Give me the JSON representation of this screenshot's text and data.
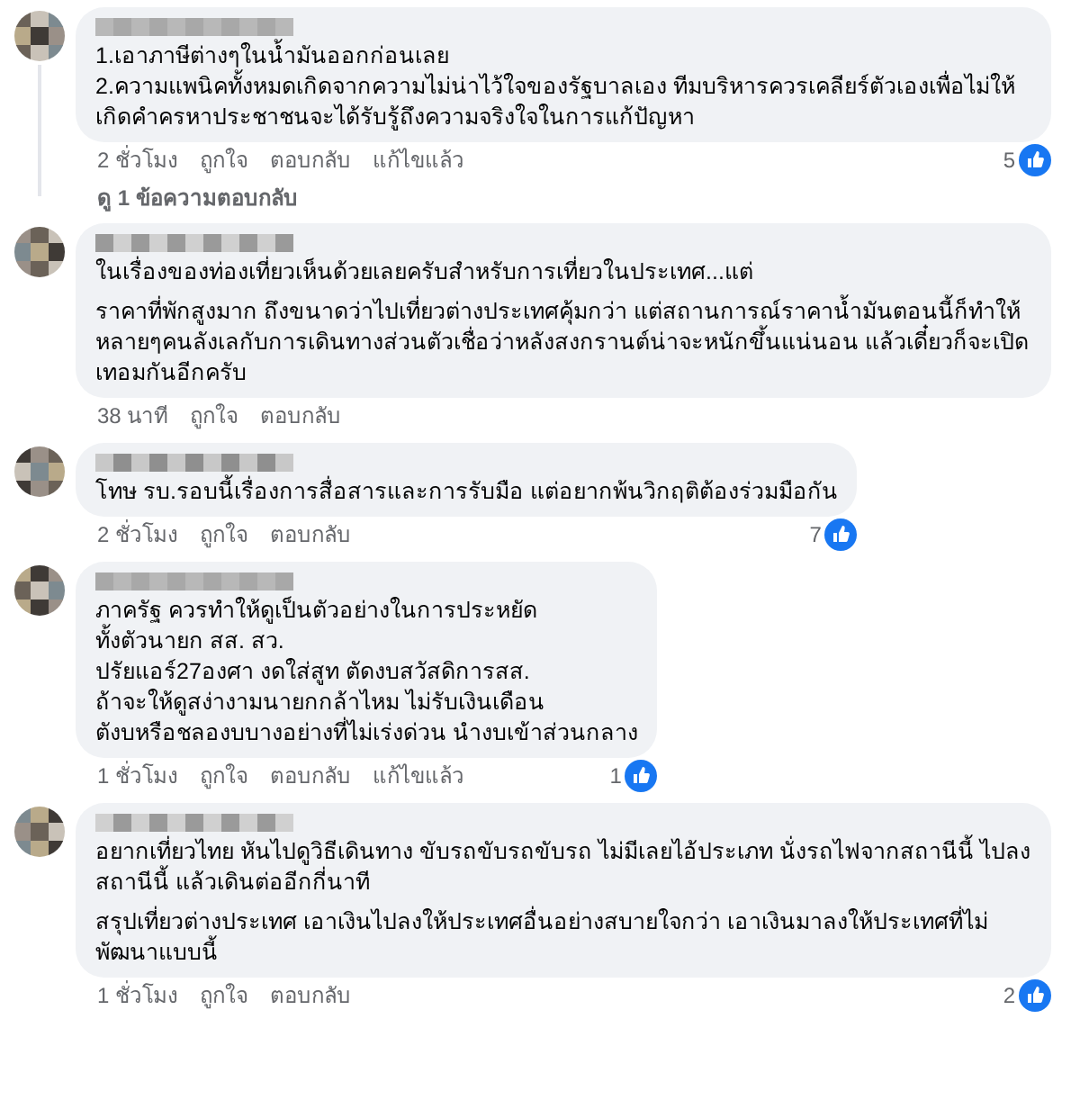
{
  "comments": [
    {
      "paragraphs": [
        [
          "1.เอาภาษีต่างๆในน้ำมันออกก่อนเลย",
          "2.ความแพนิคทั้งหมดเกิดจากความไม่น่าไว้ใจของรัฐบาลเอง ทีมบริหารควรเคลียร์ตัวเองเพื่อไม่ให้เกิดคำครหาประชาชนจะได้รับรู้ถึงความจริงใจในการแก้ปัญหา"
        ]
      ],
      "time": "2 ชั่วโมง",
      "like": "ถูกใจ",
      "reply": "ตอบกลับ",
      "edited": "แก้ไขแล้ว",
      "reactions": "5",
      "replies_link": "ดู 1 ข้อความตอบกลับ"
    },
    {
      "paragraphs": [
        [
          "ในเรื่องของท่องเที่ยวเห็นด้วยเลยครับสำหรับการเที่ยวในประเทศ...แต่"
        ],
        [
          "ราคาที่พักสูงมาก ถึงขนาดว่าไปเที่ยวต่างประเทศคุ้มกว่า แต่สถานการณ์ราคาน้ำมันตอนนี้ก็ทำให้หลายๆคนลังเลกับการเดินทางส่วนตัวเชื่อว่าหลังสงกรานต์น่าจะหนักขึ้นแน่นอน แล้วเดี๋ยวก็จะเปิดเทอมกันอีกครับ"
        ]
      ],
      "time": "38 นาที",
      "like": "ถูกใจ",
      "reply": "ตอบกลับ"
    },
    {
      "paragraphs": [
        [
          "โทษ รบ.รอบนี้เรื่องการสื่อสารและการรับมือ แต่อยากพ้นวิกฤติต้องร่วมมือกัน"
        ]
      ],
      "time": "2 ชั่วโมง",
      "like": "ถูกใจ",
      "reply": "ตอบกลับ",
      "reactions": "7"
    },
    {
      "paragraphs": [
        [
          "ภาครัฐ ควรทำให้ดูเป็นตัวอย่างในการประหยัด",
          "ทั้งตัวนายก สส. สว.",
          "ปรัยแอร์27องศา งดใส่สูท ตัดงบสวัสดิการสส.",
          "ถ้าจะให้ดูสง่างามนายกกล้าไหม ไม่รับเงินเดือน",
          "ตังบหรือชลองบบางอย่างที่ไม่เร่งด่วน นำงบเข้าส่วนกลาง"
        ]
      ],
      "time": "1 ชั่วโมง",
      "like": "ถูกใจ",
      "reply": "ตอบกลับ",
      "edited": "แก้ไขแล้ว",
      "reactions": "1"
    },
    {
      "paragraphs": [
        [
          "อยากเที่ยวไทย หันไปดูวิธีเดินทาง ขับรถขับรถขับรถ ไม่มีเลยไอ้ประเภท นั่งรถไฟจากสถานีนี้ ไปลงสถานีนี้ แล้วเดินต่ออีกกี่นาที"
        ],
        [
          "สรุปเที่ยวต่างประเทศ เอาเงินไปลงให้ประเทศอื่นอย่างสบายใจกว่า เอาเงินมาลงให้ประเทศที่ไม่พัฒนาแบบนี้"
        ]
      ],
      "time": "1 ชั่วโมง",
      "like": "ถูกใจ",
      "reply": "ตอบกลับ",
      "reactions": "2"
    }
  ]
}
